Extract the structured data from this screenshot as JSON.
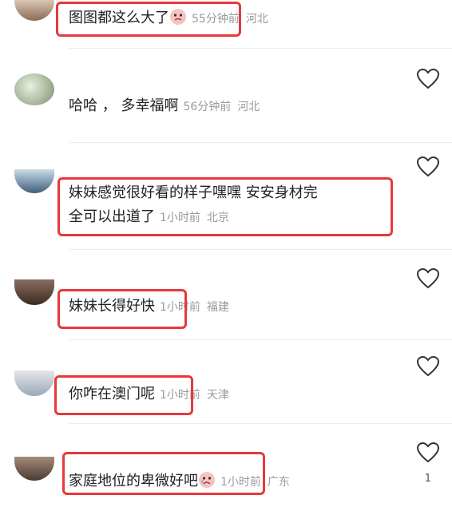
{
  "comments": [
    {
      "text": "图图都这么大了",
      "time": "55分钟前",
      "location": "河北",
      "emoji": "crying-face-icon",
      "likes": ""
    },
    {
      "text": "哈哈 ， 多幸福啊",
      "time": "56分钟前",
      "location": "河北",
      "likes": ""
    },
    {
      "text_line1": "妹妹感觉很好看的样子嘿嘿 安安身材完",
      "text_line2": "全可以出道了",
      "time": "1小时前",
      "location": "北京",
      "likes": ""
    },
    {
      "text": "妹妹长得好快",
      "time": "1小时前",
      "location": "福建",
      "likes": ""
    },
    {
      "text": "你咋在澳门呢",
      "time": "1小时前",
      "location": "天津",
      "likes": ""
    },
    {
      "text": "家庭地位的卑微好吧",
      "time": "1小时前",
      "location": "广东",
      "emoji": "crying-face-icon",
      "likes": "1"
    }
  ],
  "colors": {
    "highlight": "#e8383a",
    "meta": "#9a9a9a",
    "text": "#222222"
  }
}
